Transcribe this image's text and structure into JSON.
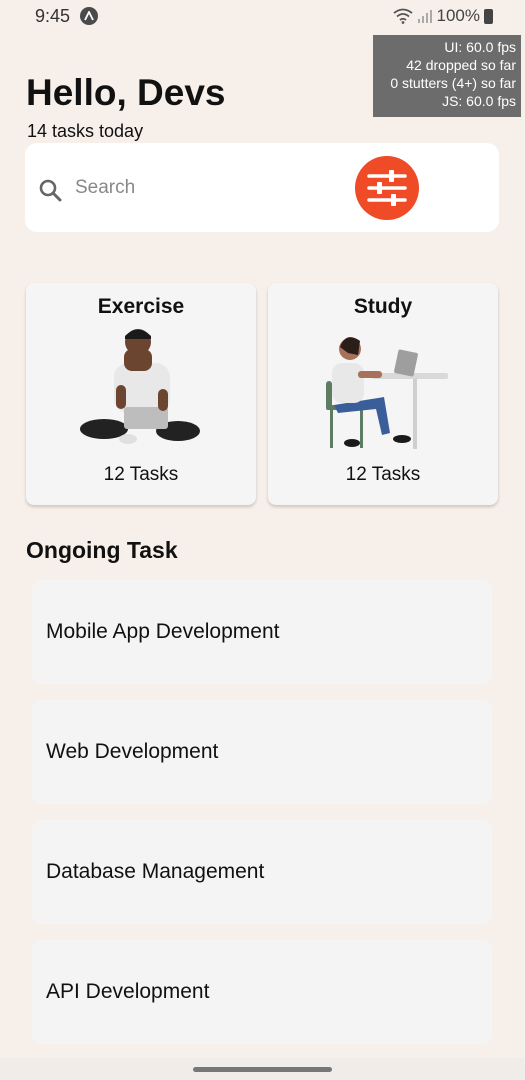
{
  "status_bar": {
    "time": "9:45",
    "battery": "100%",
    "icons": [
      "app-notification-icon",
      "wifi-icon",
      "signal-icon",
      "battery-icon"
    ]
  },
  "perf_overlay": {
    "line1": "UI: 60.0 fps",
    "line2": "42 dropped so far",
    "line3": "0 stutters (4+) so far",
    "line4": "JS: 60.0 fps"
  },
  "header": {
    "greeting": "Hello, Devs",
    "subtitle": "14 tasks today"
  },
  "search": {
    "placeholder": "Search",
    "accent_color": "#ef4b27"
  },
  "categories": [
    {
      "title": "Exercise",
      "count": "12 Tasks"
    },
    {
      "title": "Study",
      "count": "12 Tasks"
    }
  ],
  "ongoing": {
    "title": "Ongoing Task",
    "items": [
      {
        "label": "Mobile App Development"
      },
      {
        "label": "Web Development"
      },
      {
        "label": "Database Management"
      },
      {
        "label": "API Development"
      }
    ]
  }
}
